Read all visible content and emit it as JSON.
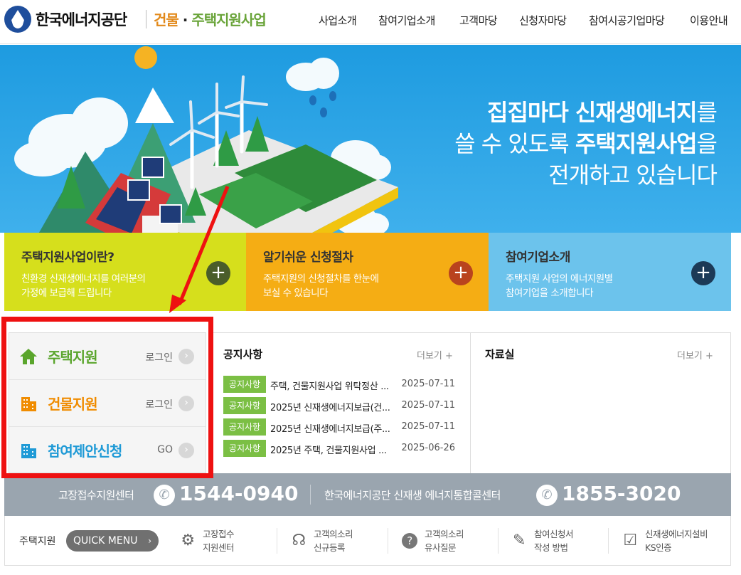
{
  "header": {
    "logo_text": "한국에너지공단",
    "site_title_a": "건물",
    "site_title_dot": "·",
    "site_title_b": "주택지원사업",
    "nav": [
      "사업소개",
      "참여기업소개",
      "고객마당",
      "신청자마당",
      "참여시공기업마당",
      "이용안내"
    ]
  },
  "hero": {
    "line1_bold": "집집마다 신재생에너지",
    "line1_rest": "를",
    "line2_pre": "쓸 수 있도록 ",
    "line2_bold": "주택지원사업",
    "line2_rest": "을",
    "line3": "전개하고 있습니다"
  },
  "cards": [
    {
      "title": "주택지원사업이란?",
      "desc1": "친환경 신재생에너지를 여러분의",
      "desc2": "가정에 보급해 드립니다",
      "bg": "#d6df1c",
      "btn": "#4a5d2a"
    },
    {
      "title": "알기쉬운 신청절차",
      "desc1": "주택지원의 신청절차를 한눈에",
      "desc2": "보실 수 있습니다",
      "bg": "#f5ad14",
      "btn": "#b9431e"
    },
    {
      "title": "참여기업소개",
      "desc1": "주택지원 사업의 에너지원별",
      "desc2": "참여기업을 소개합니다",
      "bg": "#6cc3ec",
      "btn": "#1c3a57"
    }
  ],
  "login_links": [
    {
      "name": "주택지원",
      "action": "로그인",
      "color": "#5aa52c"
    },
    {
      "name": "건물지원",
      "action": "로그인",
      "color": "#f08c00"
    },
    {
      "name": "참여제안신청",
      "action": "GO",
      "color": "#1f9ad6"
    }
  ],
  "notice": {
    "title": "공지사항",
    "more": "더보기 +",
    "tag": "공지사항",
    "items": [
      {
        "title": "주택, 건물지원사업 위탁정산 ...",
        "date": "2025-07-11"
      },
      {
        "title": "2025년 신재생에너지보급(건...",
        "date": "2025-07-11"
      },
      {
        "title": "2025년 신재생에너지보급(주...",
        "date": "2025-07-11"
      },
      {
        "title": "2025년 주택, 건물지원사업 ...",
        "date": "2025-06-26"
      }
    ]
  },
  "resources": {
    "title": "자료실",
    "more": "더보기 +"
  },
  "callcenter": {
    "label1": "고장접수지원센터",
    "num1": "1544-0940",
    "label2": "한국에너지공단 신재생 에너지통합콜센터",
    "num2": "1855-3020"
  },
  "quick": {
    "label": "주택지원",
    "button": "QUICK MENU",
    "items": [
      {
        "l1": "고장접수",
        "l2": "지원센터",
        "icon": "gear-icon"
      },
      {
        "l1": "고객의소리",
        "l2": "신규등록",
        "icon": "headset-icon"
      },
      {
        "l1": "고객의소리",
        "l2": "유사질문",
        "icon": "question-icon"
      },
      {
        "l1": "참여신청서",
        "l2": "작성 방법",
        "icon": "edit-list-icon"
      },
      {
        "l1": "신재생에너지설비",
        "l2": "KS인증",
        "icon": "clipboard-check-icon"
      }
    ]
  }
}
